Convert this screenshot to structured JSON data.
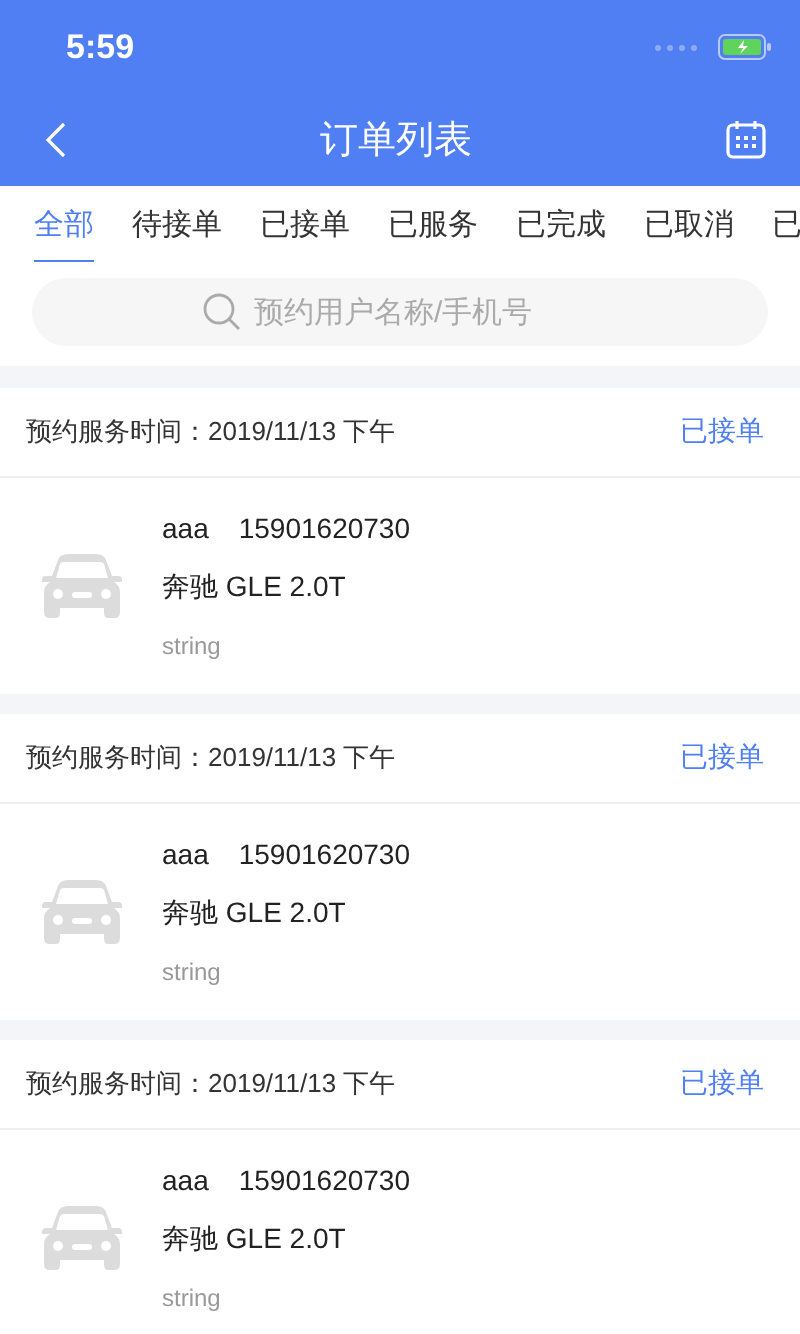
{
  "status_bar": {
    "time": "5:59"
  },
  "nav": {
    "title": "订单列表"
  },
  "tabs": [
    {
      "label": "全部",
      "selected": true
    },
    {
      "label": "待接单",
      "selected": false
    },
    {
      "label": "已接单",
      "selected": false
    },
    {
      "label": "已服务",
      "selected": false
    },
    {
      "label": "已完成",
      "selected": false
    },
    {
      "label": "已取消",
      "selected": false
    },
    {
      "label": "已",
      "selected": false
    }
  ],
  "search": {
    "placeholder": "预约用户名称/手机号"
  },
  "orders": [
    {
      "time": "预约服务时间：2019/11/13 下午",
      "status": "已接单",
      "name": "aaa",
      "phone": "15901620730",
      "car": "奔驰 GLE 2.0T",
      "note": "string"
    },
    {
      "time": "预约服务时间：2019/11/13 下午",
      "status": "已接单",
      "name": "aaa",
      "phone": "15901620730",
      "car": "奔驰 GLE 2.0T",
      "note": "string"
    },
    {
      "time": "预约服务时间：2019/11/13 下午",
      "status": "已接单",
      "name": "aaa",
      "phone": "15901620730",
      "car": "奔驰 GLE 2.0T",
      "note": "string"
    }
  ]
}
